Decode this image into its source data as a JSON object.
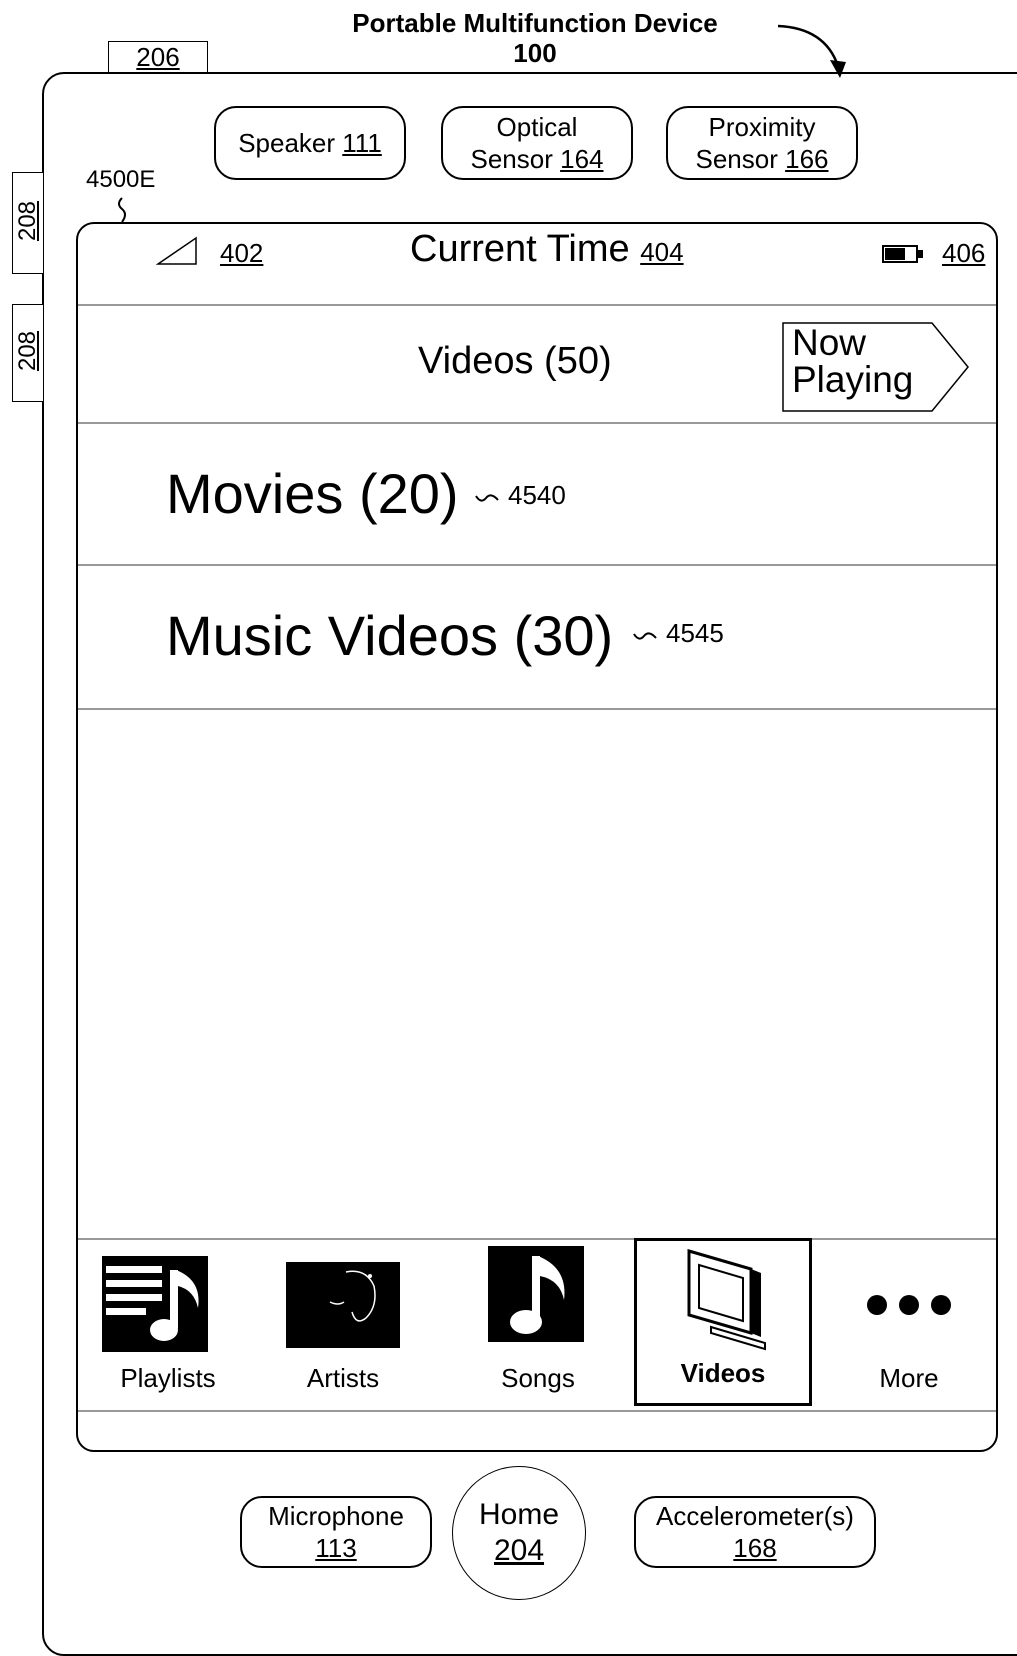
{
  "device": {
    "title_line1": "Portable Multifunction Device",
    "title_line2": "100",
    "ref_top": "206",
    "ref_side_a": "208",
    "ref_side_b": "208",
    "screen_ref": "4500E"
  },
  "sensors": {
    "speaker": {
      "label": "Speaker",
      "num": "111"
    },
    "optical": {
      "label1": "Optical",
      "label2": "Sensor",
      "num": "164"
    },
    "proximity": {
      "label1": "Proximity",
      "label2": "Sensor",
      "num": "166"
    }
  },
  "status_bar": {
    "signal_ref": "402",
    "time_label": "Current Time",
    "time_ref": "404",
    "battery_ref": "406"
  },
  "nav_bar": {
    "title": "Videos (50)",
    "now_playing_line1": "Now",
    "now_playing_line2": "Playing"
  },
  "list": {
    "items": [
      {
        "label": "Movies (20)",
        "ref": "4540"
      },
      {
        "label": "Music Videos (30)",
        "ref": "4545"
      }
    ]
  },
  "tab_bar": {
    "tabs": [
      {
        "label": "Playlists",
        "icon": "playlist-icon"
      },
      {
        "label": "Artists",
        "icon": "artist-icon"
      },
      {
        "label": "Songs",
        "icon": "music-note-icon"
      },
      {
        "label": "Videos",
        "icon": "tv-icon",
        "selected": true
      },
      {
        "label": "More",
        "icon": "more-icon"
      }
    ]
  },
  "hardware": {
    "microphone": {
      "label": "Microphone",
      "num": "113"
    },
    "home": {
      "label": "Home",
      "num": "204"
    },
    "accelerometer": {
      "label": "Accelerometer(s)",
      "num": "168"
    }
  }
}
